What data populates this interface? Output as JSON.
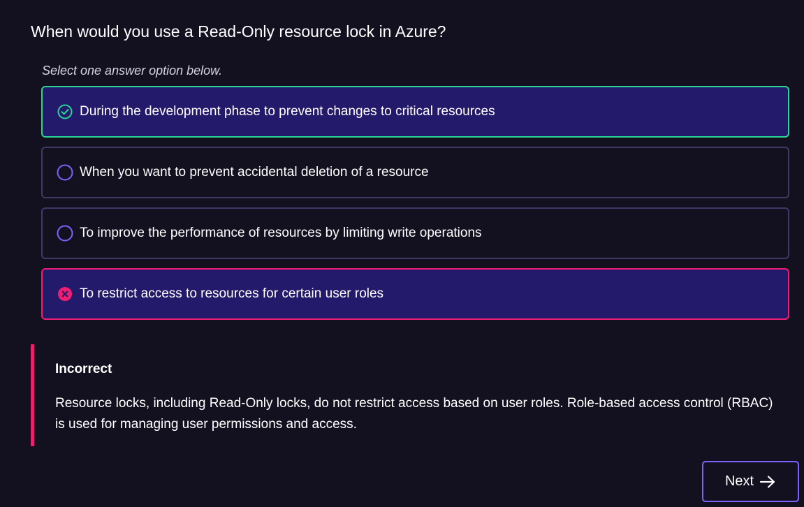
{
  "question": {
    "text": "When would you use a Read-Only resource lock in Azure?"
  },
  "instruction": "Select one answer option below.",
  "options": [
    {
      "label": "During the development phase to prevent changes to critical resources",
      "state": "correct",
      "icon": "check-circle-icon"
    },
    {
      "label": "When you want to prevent accidental deletion of a resource",
      "state": "unselected",
      "icon": "radio-empty-icon"
    },
    {
      "label": "To improve the performance of resources by limiting write operations",
      "state": "unselected",
      "icon": "radio-empty-icon"
    },
    {
      "label": "To restrict access to resources for certain user roles",
      "state": "incorrect",
      "icon": "x-circle-icon"
    }
  ],
  "feedback": {
    "title": "Incorrect",
    "text": "Resource locks, including Read-Only locks, do not restrict access based on user roles. Role-based access control (RBAC) is used for managing user permissions and access."
  },
  "next_button": {
    "label": "Next",
    "icon": "arrow-right-icon"
  },
  "colors": {
    "background": "#13111f",
    "correct_border": "#2ad497",
    "incorrect_border": "#ee1f72",
    "selected_fill": "#231a6b",
    "default_border": "#3d3a66",
    "radio_stroke": "#7a63ff",
    "button_border": "#7a63ff"
  }
}
